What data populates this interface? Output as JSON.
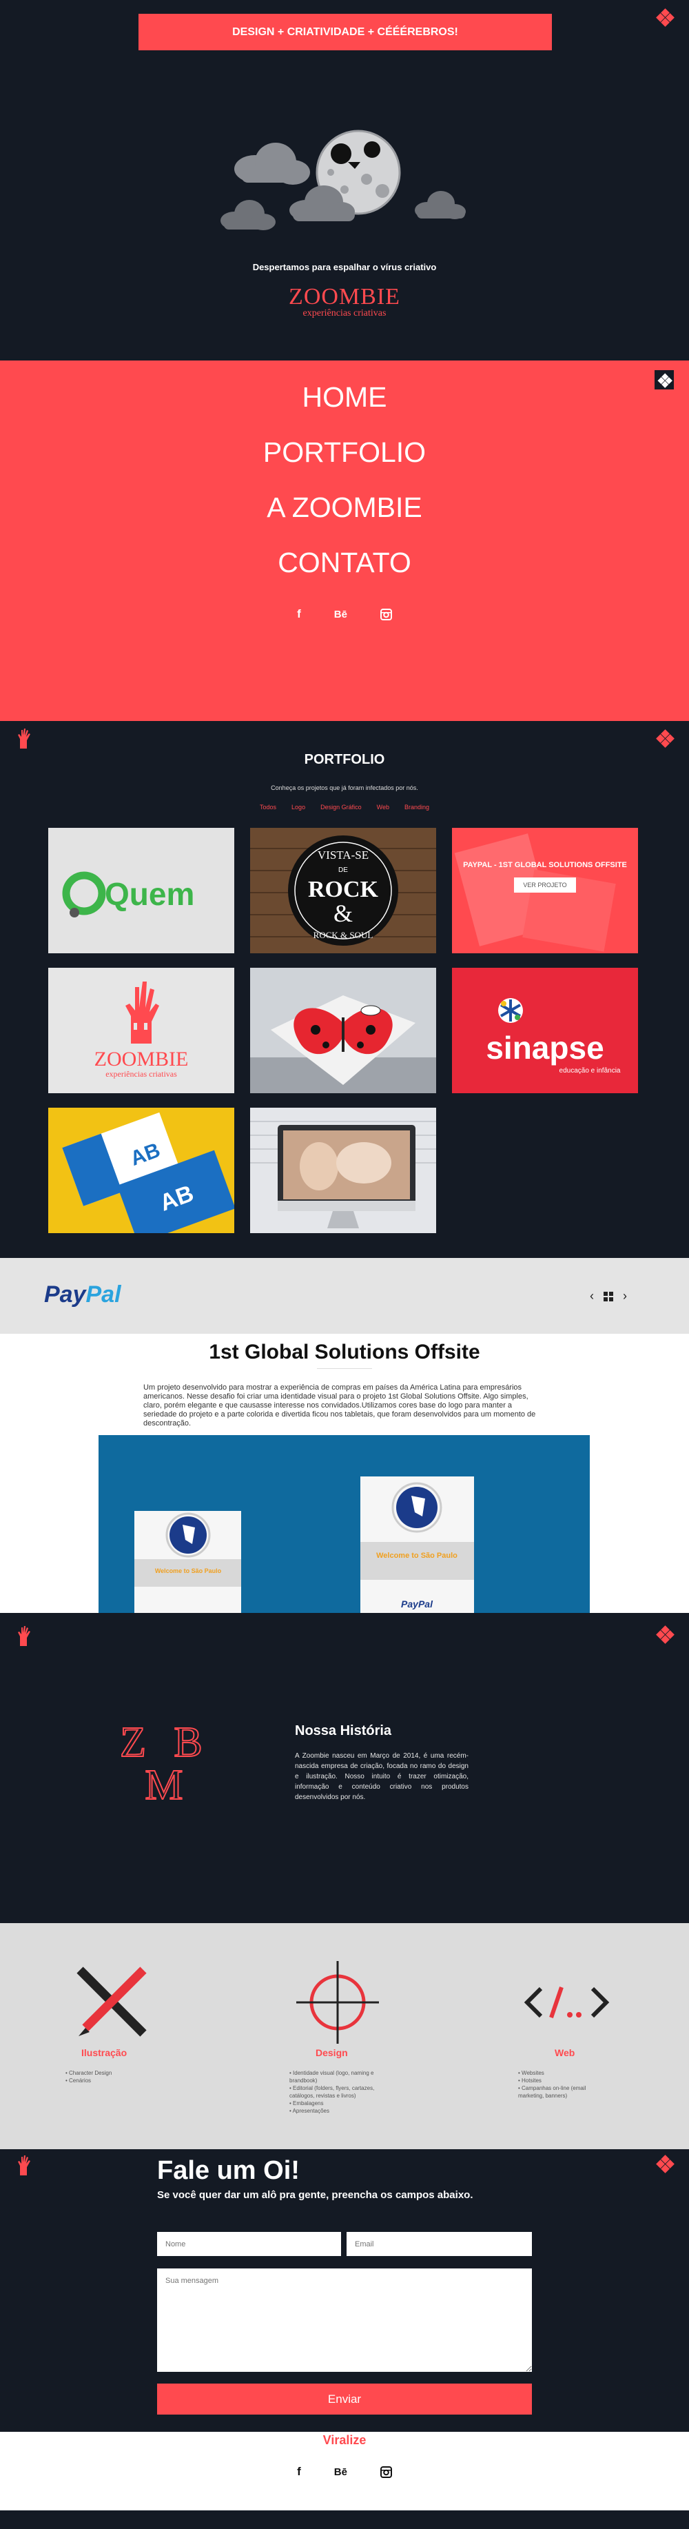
{
  "hero": {
    "banner": "DESIGN + CRIATIVIDADE + CÉÉÉREBROS!",
    "tagline": "Despertamos para espalhar o vírus criativo",
    "brand": "ZOOMBIE",
    "brand_sub": "experiências criativas"
  },
  "menu": {
    "items": [
      "HOME",
      "PORTFOLIO",
      "A ZOOMBIE",
      "CONTATO"
    ],
    "social": [
      "f",
      "Bē",
      "instagram"
    ]
  },
  "portfolio": {
    "title": "PORTFOLIO",
    "subtitle": "Conheça os projetos que já foram infectados por nós.",
    "filters": [
      "Todos",
      "Logo",
      "Design Gráfico",
      "Web",
      "Branding"
    ],
    "tiles": {
      "quem": "Quem",
      "rock_top": "VISTA-SE",
      "rock_de": "DE",
      "rock_main": "ROCK",
      "rock_amp": "&",
      "rock_sub": "ROCK & SOUL",
      "paypal_caption": "PAYPAL - 1ST GLOBAL SOLUTIONS OFFSITE",
      "paypal_button": "VER PROJETO",
      "zoombie": "ZOOMBIE",
      "zoombie_sub": "experiências criativas",
      "sinapse": "sinapse",
      "sinapse_sub": "educação e infância",
      "ab": "AB"
    }
  },
  "project": {
    "logo_a": "Pay",
    "logo_b": "Pal",
    "title": "1st Global Solutions Offsite",
    "description": "Um projeto desenvolvido para mostrar a experiência de compras em países da América Latina para empresários americanos. Nesse desafio foi criar uma identidade visual para o projeto 1st Global Solutions Offsite. Algo simples, claro, porém elegante e que causasse interesse nos convidados.Utilizamos cores base do logo para manter a seriedade do projeto e a parte colorida e divertida ficou nos tabletais, que foram desenvolvidos para um momento de descontração.",
    "book_title": "Welcome to São Paulo",
    "book_logo": "PayPal"
  },
  "about": {
    "logo_letters": [
      "Z",
      "B",
      "M"
    ],
    "title": "Nossa História",
    "text": "A Zoombie nasceu em Março de 2014, é uma recém-nascida empresa de criação, focada no ramo do design e ilustração. Nosso intuito é trazer otimização, informação e conteúdo criativo nos produtos desenvolvidos por nós."
  },
  "services": [
    {
      "title": "Ilustração",
      "items": [
        "Character Design",
        "Cenários"
      ]
    },
    {
      "title": "Design",
      "items": [
        "Identidade visual (logo, naming e brandbook)",
        "Editorial (folders, flyers, cartazes, catálogos, revistas e livros)",
        "Embalagens",
        "Apresentações"
      ]
    },
    {
      "title": "Web",
      "items": [
        "Websites",
        "Hotsites",
        "Campanhas on-line (email marketing, banners)"
      ]
    }
  ],
  "contact": {
    "title": "Fale um Oi!",
    "subtitle": "Se você quer dar um alô pra gente, preencha os campos abaixo.",
    "name_placeholder": "Nome",
    "email_placeholder": "Email",
    "message_placeholder": "Sua mensagem",
    "submit": "Enviar"
  },
  "footer": {
    "title": "Viralize",
    "social": [
      "f",
      "Bē",
      "instagram"
    ]
  },
  "colors": {
    "accent": "#ff4a4f",
    "dark": "#141a24",
    "light_gray": "#dcdcdc"
  }
}
